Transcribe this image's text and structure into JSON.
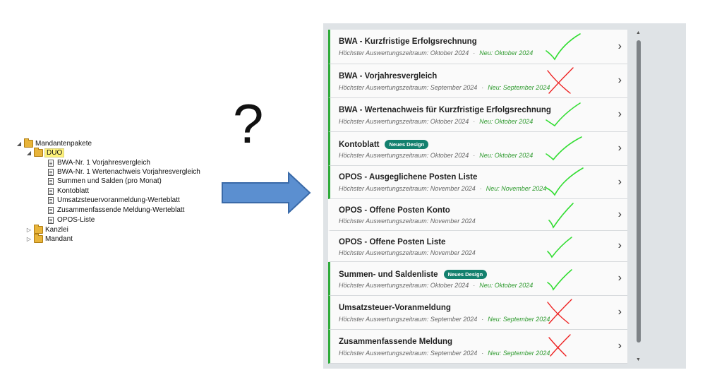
{
  "tree": {
    "root": "Mandantenpakete",
    "selected": "DUO",
    "children": [
      "BWA-Nr. 1 Vorjahresvergleich",
      "BWA-Nr. 1 Wertenachweis Vorjahresvergleich",
      "Summen und Salden (pro Monat)",
      "Kontoblatt",
      "Umsatzsteuervoranmeldung-Werteblatt",
      "Zusammenfassende Meldung-Werteblatt",
      "OPOS-Liste"
    ],
    "siblings": [
      "Kanzlei",
      "Mandant"
    ]
  },
  "question_mark": "?",
  "colors": {
    "arrow_fill": "#5b8fd0",
    "accent": "#2eab3a",
    "badge": "#13806e",
    "check": "#33dd33",
    "cross": "#ee2222"
  },
  "reports": [
    {
      "title": "BWA - Kurzfristige Erfolgsrechnung",
      "badge": "",
      "subtitle": "Höchster Auswertungszeitraum: Oktober 2024",
      "sep": "·",
      "neu": "Neu: Oktober 2024",
      "accent": true,
      "mark": "check"
    },
    {
      "title": "BWA - Vorjahresvergleich",
      "badge": "",
      "subtitle": "Höchster Auswertungszeitraum: September 2024",
      "sep": "·",
      "neu": "Neu: September 2024",
      "accent": true,
      "mark": "cross"
    },
    {
      "title": "BWA - Wertenachweis für Kurzfristige Erfolgsrechnung",
      "badge": "",
      "subtitle": "Höchster Auswertungszeitraum: Oktober 2024",
      "sep": "·",
      "neu": "Neu: Oktober 2024",
      "accent": true,
      "mark": "check"
    },
    {
      "title": "Kontoblatt",
      "badge": "Neues Design",
      "subtitle": "Höchster Auswertungszeitraum: Oktober 2024",
      "sep": "·",
      "neu": "Neu: Oktober 2024",
      "accent": true,
      "mark": "check"
    },
    {
      "title": "OPOS - Ausgeglichene Posten Liste",
      "badge": "",
      "subtitle": "Höchster Auswertungszeitraum: November 2024",
      "sep": "·",
      "neu": "Neu: November 2024",
      "accent": true,
      "mark": "check"
    },
    {
      "title": "OPOS - Offene Posten Konto",
      "badge": "",
      "subtitle": "Höchster Auswertungszeitraum: November 2024",
      "sep": "",
      "neu": "",
      "accent": false,
      "mark": "check"
    },
    {
      "title": "OPOS - Offene Posten Liste",
      "badge": "",
      "subtitle": "Höchster Auswertungszeitraum: November 2024",
      "sep": "",
      "neu": "",
      "accent": false,
      "mark": "check"
    },
    {
      "title": "Summen- und Saldenliste",
      "badge": "Neues Design",
      "subtitle": "Höchster Auswertungszeitraum: Oktober 2024",
      "sep": "·",
      "neu": "Neu: Oktober 2024",
      "accent": true,
      "mark": "check"
    },
    {
      "title": "Umsatzsteuer-Voranmeldung",
      "badge": "",
      "subtitle": "Höchster Auswertungszeitraum: September 2024",
      "sep": "·",
      "neu": "Neu: September 2024",
      "accent": true,
      "mark": "cross"
    },
    {
      "title": "Zusammenfassende Meldung",
      "badge": "",
      "subtitle": "Höchster Auswertungszeitraum: September 2024",
      "sep": "·",
      "neu": "Neu: September 2024",
      "accent": true,
      "mark": "cross"
    }
  ]
}
